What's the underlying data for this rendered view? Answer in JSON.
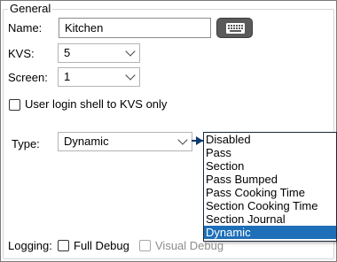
{
  "group": {
    "title": "General"
  },
  "name": {
    "label": "Name:",
    "value": "Kitchen"
  },
  "kvs": {
    "label": "KVS:",
    "value": "5"
  },
  "screen": {
    "label": "Screen:",
    "value": "1"
  },
  "user_login": {
    "label": "User login shell to KVS only",
    "checked": false
  },
  "type": {
    "label": "Type:",
    "value": "Dynamic",
    "options": [
      "Disabled",
      "Pass",
      "Section",
      "Pass Bumped",
      "Pass Cooking Time",
      "Section Cooking Time",
      "Section Journal",
      "Dynamic"
    ],
    "selected": "Dynamic"
  },
  "logging": {
    "label": "Logging:",
    "full_debug": {
      "label": "Full Debug",
      "checked": false
    },
    "visual_debug": {
      "label": "Visual Debug",
      "checked": false,
      "enabled": false
    }
  },
  "icons": {
    "keyboard": "keyboard-icon",
    "chevron": "chevron-down-icon",
    "callout": "arrow-right-icon"
  },
  "colors": {
    "selection": "#1e6fb8",
    "callout_arrow": "#0a3a6e",
    "keyboard_button": "#5a5a5a"
  }
}
